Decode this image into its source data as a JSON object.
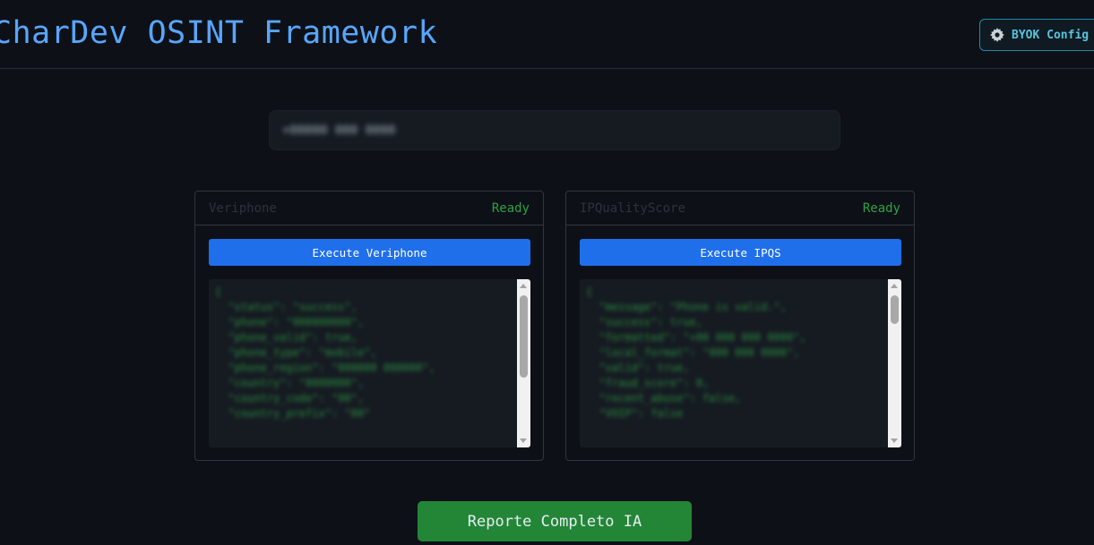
{
  "header": {
    "title": "CharDev OSINT Framework",
    "byok_label": "BYOK Config"
  },
  "search": {
    "value": "+00000 000 0000"
  },
  "panels": [
    {
      "name": "Veriphone",
      "status": "Ready",
      "button_label": "Execute Veriphone",
      "output": "{\n  \"status\": \"success\",\n  \"phone\": \"000000000\",\n  \"phone_valid\": true,\n  \"phone_type\": \"mobile\",\n  \"phone_region\": \"000000 000000\",\n  \"country\": \"0000000\",\n  \"country_code\": \"00\",\n  \"country_prefix\": \"00\""
    },
    {
      "name": "IPQualityScore",
      "status": "Ready",
      "button_label": "Execute IPQS",
      "output": "{\n  \"message\": \"Phone is valid.\",\n  \"success\": true,\n  \"formatted\": \"+00 000 000 0000\",\n  \"local_format\": \"000 000 0000\",\n  \"valid\": true,\n  \"fraud_score\": 0,\n  \"recent_abuse\": false,\n  \"VOIP\": false"
    }
  ],
  "report": {
    "label": "Reporte Completo IA"
  }
}
